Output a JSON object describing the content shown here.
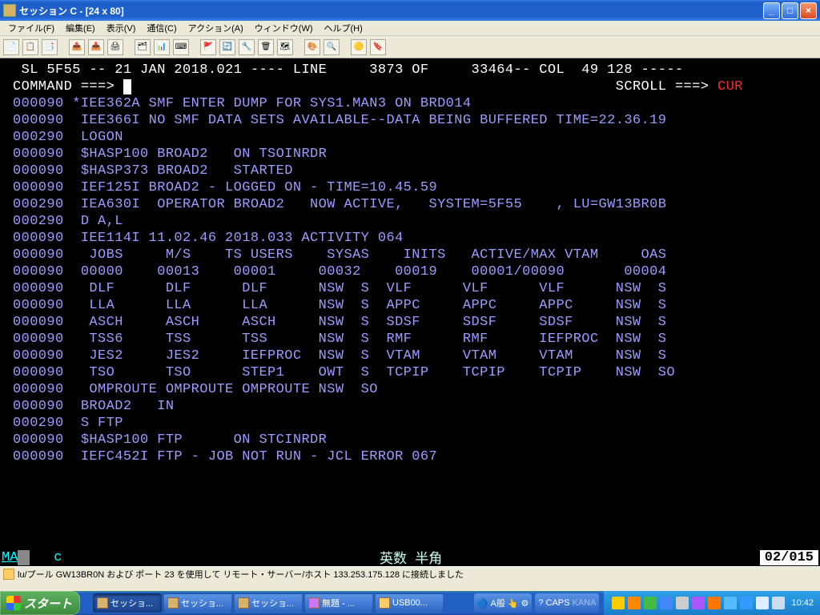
{
  "window": {
    "title": "セッション C - [24 x 80]"
  },
  "menu": {
    "file": "ファイル(F)",
    "edit": "編集(E)",
    "view": "表示(V)",
    "comm": "通信(C)",
    "action": "アクション(A)",
    "window": "ウィンドウ(W)",
    "help": "ヘルプ(H)"
  },
  "toolbar_icons": [
    "📄",
    "📋",
    "📑",
    "📤",
    "📥",
    "🖨",
    "🗂",
    "📊",
    "⌨",
    "🚩",
    "🔄",
    "🔧",
    "🗑",
    "🗺",
    "🎨",
    "🔍",
    "🟡",
    "🔖"
  ],
  "term": {
    "header_left": " SL 5F55 -- 21 JAN 2018.021 ---- LINE     3873 OF     33464-- COL  49 128 -----",
    "cmd_label": "COMMAND ===>",
    "scroll_label": "SCROLL ===>",
    "scroll_value": "CUR",
    "lines": [
      {
        "n": "000090",
        "t": "*IEE362A SMF ENTER DUMP FOR SYS1.MAN3 ON BRD014"
      },
      {
        "n": "000090",
        "t": " IEE366I NO SMF DATA SETS AVAILABLE--DATA BEING BUFFERED TIME=22.36.19"
      },
      {
        "n": "000290",
        "t": " LOGON"
      },
      {
        "n": "000090",
        "t": " $HASP100 BROAD2   ON TSOINRDR"
      },
      {
        "n": "000090",
        "t": " $HASP373 BROAD2   STARTED"
      },
      {
        "n": "000090",
        "t": " IEF125I BROAD2 - LOGGED ON - TIME=10.45.59"
      },
      {
        "n": "000290",
        "t": " IEA630I  OPERATOR BROAD2   NOW ACTIVE,   SYSTEM=5F55    , LU=GW13BR0B"
      },
      {
        "n": "000290",
        "t": " D A,L"
      },
      {
        "n": "000090",
        "t": " IEE114I 11.02.46 2018.033 ACTIVITY 064"
      },
      {
        "n": "000090",
        "t": "  JOBS     M/S    TS USERS    SYSAS    INITS   ACTIVE/MAX VTAM     OAS"
      },
      {
        "n": "000090",
        "t": " 00000    00013    00001     00032    00019    00001/00090       00004"
      },
      {
        "n": "000090",
        "t": "  DLF      DLF      DLF      NSW  S  VLF      VLF      VLF      NSW  S"
      },
      {
        "n": "000090",
        "t": "  LLA      LLA      LLA      NSW  S  APPC     APPC     APPC     NSW  S"
      },
      {
        "n": "000090",
        "t": "  ASCH     ASCH     ASCH     NSW  S  SDSF     SDSF     SDSF     NSW  S"
      },
      {
        "n": "000090",
        "t": "  TSS6     TSS      TSS      NSW  S  RMF      RMF      IEFPROC  NSW  S"
      },
      {
        "n": "000090",
        "t": "  JES2     JES2     IEFPROC  NSW  S  VTAM     VTAM     VTAM     NSW  S"
      },
      {
        "n": "000090",
        "t": "  TSO      TSO      STEP1    OWT  S  TCPIP    TCPIP    TCPIP    NSW  SO"
      },
      {
        "n": "000090",
        "t": "  OMPROUTE OMPROUTE OMPROUTE NSW  SO"
      },
      {
        "n": "000090",
        "t": " BROAD2   IN"
      },
      {
        "n": "000290",
        "t": " S FTP"
      },
      {
        "n": "000090",
        "t": " $HASP100 FTP      ON STCINRDR"
      },
      {
        "n": "000090",
        "t": " IEFC452I FTP - JOB NOT RUN - JCL ERROR 067"
      }
    ]
  },
  "osia": {
    "left_ma": "MA",
    "left_c": "c",
    "center": "英数 半角",
    "right": "02/015"
  },
  "statusbar": {
    "text": "lu/プール GW13BR0N および ポート 23 を使用して リモート・サーバー/ホスト 133.253.175.128 に接続しました"
  },
  "taskbar": {
    "start": "スタート",
    "buttons": [
      {
        "label": "セッショ...",
        "active": true,
        "kind": "pcomm"
      },
      {
        "label": "セッショ...",
        "active": false,
        "kind": "pcomm"
      },
      {
        "label": "セッショ...",
        "active": false,
        "kind": "pcomm"
      },
      {
        "label": "無題 - ...",
        "active": false,
        "kind": "paint"
      },
      {
        "label": "USB00...",
        "active": false,
        "kind": "folder"
      }
    ],
    "ime": {
      "globe": "🔵",
      "aban": "A般",
      "hand": "👆",
      "tool": "⚙",
      "help": "?",
      "caps": "CAPS",
      "kana": "KANA"
    },
    "tray_icons": [
      "🟨",
      "🟧",
      "🟩",
      "🛡",
      "🔊",
      "🟣",
      "🟠",
      "🟦",
      "🔵",
      "🖥",
      "🖱"
    ],
    "clock": "10:42"
  }
}
